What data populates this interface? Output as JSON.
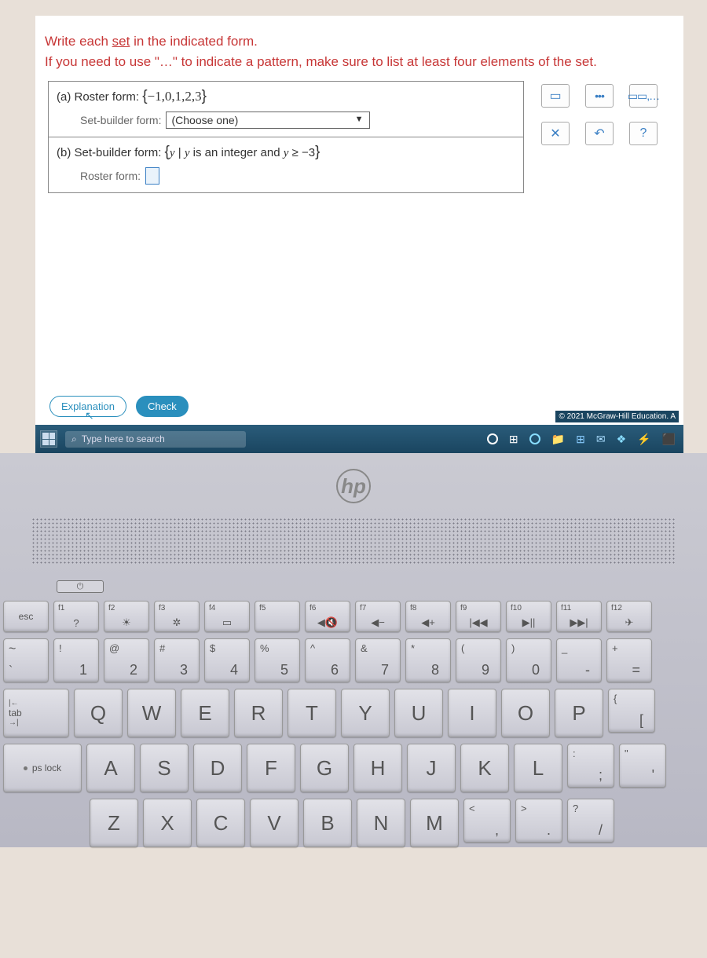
{
  "chevron_icon": "∨",
  "instructions": {
    "line1a": "Write each ",
    "line1_underline": "set",
    "line1b": " in the indicated form.",
    "line2": "If you need to use \"…\" to indicate a pattern, make sure to list at least four elements of the set."
  },
  "part_a": {
    "label": "(a)  Roster form: ",
    "set_open": "{",
    "set_vals": "−1,0,1,2,3",
    "set_close": "}",
    "sub_label": "Set-builder form:",
    "dropdown_value": "(Choose one)"
  },
  "part_b": {
    "label_prefix": "(b)  Set-builder form: ",
    "set_open": "{",
    "y1": "y",
    "mid": " | ",
    "y2": "y",
    "cond": " is an integer and ",
    "y3": "y",
    "ineq": " ≥ −3",
    "set_close": "}",
    "sub_label": "Roster form:"
  },
  "tools": {
    "empty_set": "▭",
    "ellipsis": "•••",
    "empty_list": "▭▭,…",
    "close": "✕",
    "undo": "↶",
    "help": "?"
  },
  "actions": {
    "explanation": "Explanation",
    "check": "Check",
    "cursor": "↖"
  },
  "copyright": "© 2021 McGraw-Hill Education. A",
  "taskbar": {
    "search_placeholder": "Type here to search"
  },
  "hp": "hp",
  "power": "⏻",
  "keys": {
    "fn": [
      {
        "t": "f1",
        "s": "?"
      },
      {
        "t": "f2",
        "s": "☀"
      },
      {
        "t": "f3",
        "s": "✲"
      },
      {
        "t": "f4",
        "s": "▭"
      },
      {
        "t": "f5",
        "s": ""
      },
      {
        "t": "f6",
        "s": "◀🔇"
      },
      {
        "t": "f7",
        "s": "◀−"
      },
      {
        "t": "f8",
        "s": "◀+"
      },
      {
        "t": "f9",
        "s": "|◀◀"
      },
      {
        "t": "f10",
        "s": "▶||"
      },
      {
        "t": "f11",
        "s": "▶▶|"
      },
      {
        "t": "f12",
        "s": "✈"
      }
    ],
    "esc": "esc",
    "tilde": {
      "t": "~",
      "b": "`"
    },
    "nums": [
      {
        "t": "!",
        "b": "1"
      },
      {
        "t": "@",
        "b": "2"
      },
      {
        "t": "#",
        "b": "3"
      },
      {
        "t": "$",
        "b": "4"
      },
      {
        "t": "%",
        "b": "5"
      },
      {
        "t": "^",
        "b": "6"
      },
      {
        "t": "&",
        "b": "7"
      },
      {
        "t": "*",
        "b": "8"
      },
      {
        "t": "(",
        "b": "9"
      },
      {
        "t": ")",
        "b": "0"
      },
      {
        "t": "_",
        "b": "-"
      },
      {
        "t": "+",
        "b": "="
      }
    ],
    "tab": "tab",
    "tab_sym_top": "|←",
    "tab_sym_bot": "→|",
    "qwerty": [
      "Q",
      "W",
      "E",
      "R",
      "T",
      "Y",
      "U",
      "I",
      "O",
      "P"
    ],
    "bracket": {
      "t": "{",
      "b": "["
    },
    "caps": "ps lock",
    "asdf": [
      "A",
      "S",
      "D",
      "F",
      "G",
      "H",
      "J",
      "K",
      "L"
    ],
    "semi": {
      "t": ":",
      "b": ";"
    },
    "quote": {
      "t": "\"",
      "b": "'"
    },
    "zxcv": [
      "Z",
      "X",
      "C",
      "V",
      "B",
      "N",
      "M"
    ],
    "comma": {
      "t": "<",
      "b": ","
    },
    "period": {
      "t": ">",
      "b": "."
    },
    "slash": {
      "t": "?",
      "b": "/"
    }
  }
}
